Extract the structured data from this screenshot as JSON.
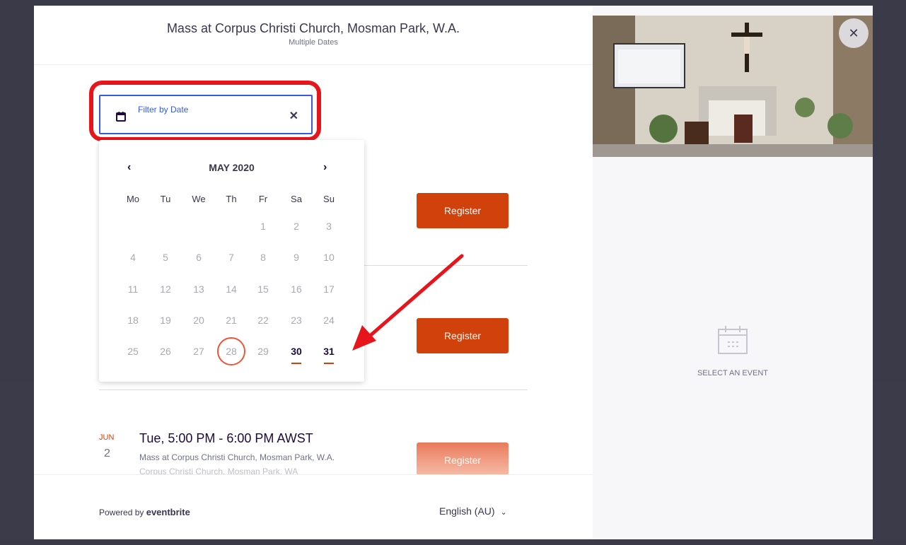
{
  "header": {
    "title": "Mass at Corpus Christi Church, Mosman Park, W.A.",
    "subtitle": "Multiple Dates"
  },
  "filter": {
    "label": "Filter by Date",
    "clear": "✕"
  },
  "calendar": {
    "prev": "‹",
    "next": "›",
    "month": "MAY 2020",
    "weekdays": [
      "Mo",
      "Tu",
      "We",
      "Th",
      "Fr",
      "Sa",
      "Su"
    ],
    "days": [
      "1",
      "2",
      "3",
      "4",
      "5",
      "6",
      "7",
      "8",
      "9",
      "10",
      "11",
      "12",
      "13",
      "14",
      "15",
      "16",
      "17",
      "18",
      "19",
      "20",
      "21",
      "22",
      "23",
      "24",
      "25",
      "26",
      "27",
      "28",
      "29",
      "30",
      "31"
    ]
  },
  "events": {
    "register_label": "Register",
    "third": {
      "month": "JUN",
      "day": "2",
      "time": "Tue, 5:00 PM - 6:00 PM AWST",
      "name": "Mass at Corpus Christi Church, Mosman Park, W.A.",
      "location": "Corpus Christi Church, Mosman Park, WA"
    }
  },
  "footer": {
    "powered_by": "Powered by",
    "brand": "eventbrite",
    "language": "English (AU)"
  },
  "right_panel": {
    "close": "✕",
    "select_text": "SELECT AN EVENT"
  },
  "colors": {
    "accent": "#d1410c",
    "focus": "#3659e3",
    "highlight": "#e8141b"
  }
}
